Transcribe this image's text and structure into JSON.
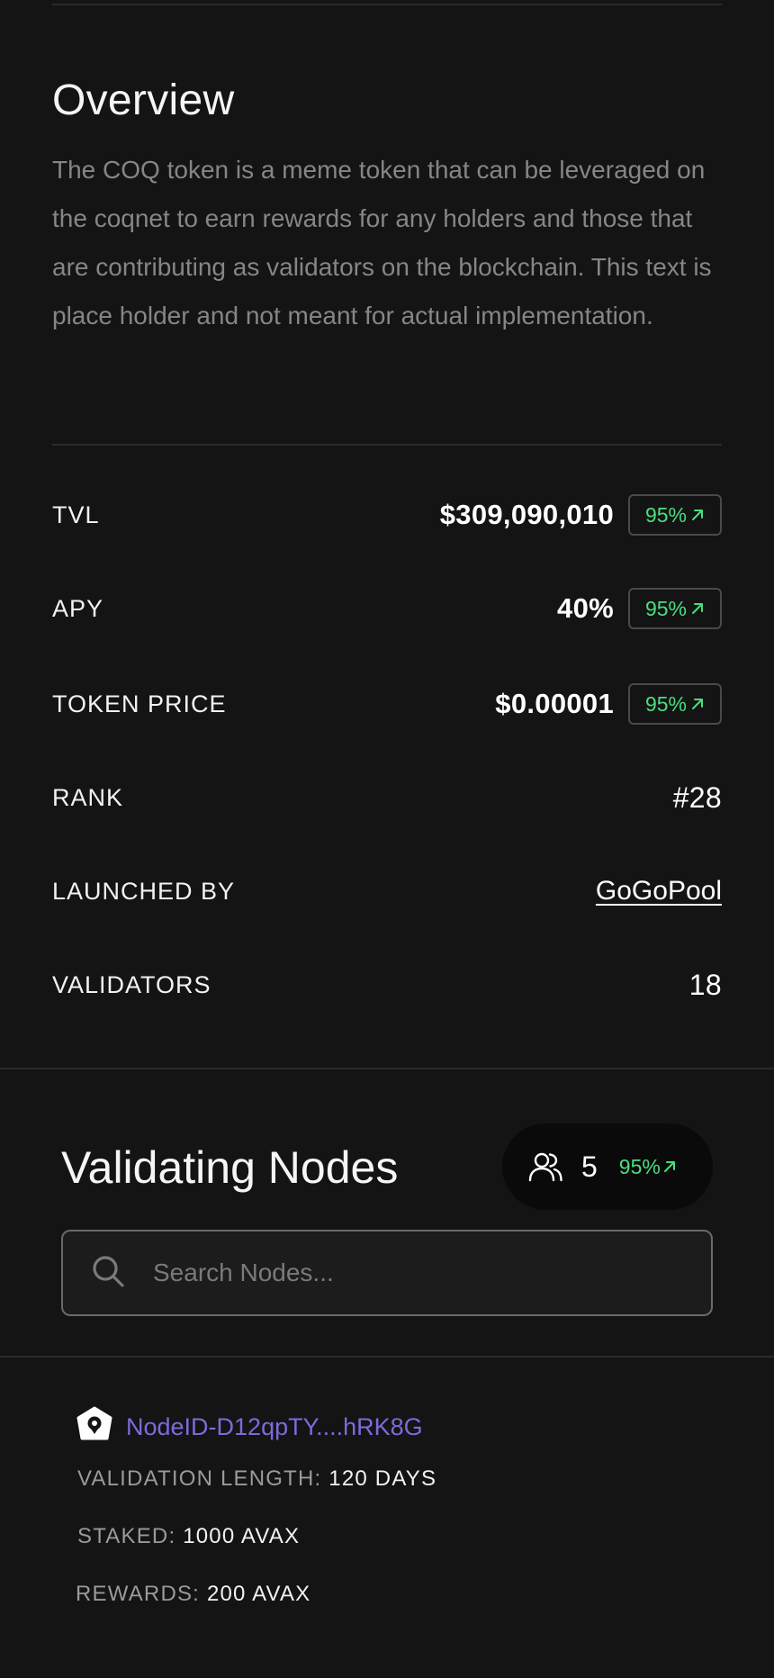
{
  "overview": {
    "title": "Overview",
    "description": "The COQ token is a meme token that can be leveraged on the coqnet to earn rewards for any holders and those that are contributing as validators on the blockchain. This text is place holder and not meant for actual implementation."
  },
  "stats": {
    "tvl": {
      "label": "TVL",
      "value": "$309,090,010",
      "change": "95%"
    },
    "apy": {
      "label": "APY",
      "value": "40%",
      "change": "95%"
    },
    "token_price": {
      "label": "TOKEN PRICE",
      "value": "$0.00001",
      "change": "95%"
    },
    "rank": {
      "label": "RANK",
      "value": "#28"
    },
    "launched_by": {
      "label": "LAUNCHED BY",
      "value": "GoGoPool"
    },
    "validators": {
      "label": "VALIDATORS",
      "value": "18"
    }
  },
  "nodes": {
    "title": "Validating Nodes",
    "count": "5",
    "change": "95%",
    "search_placeholder": "Search Nodes...",
    "items": [
      {
        "id": "NodeID-D12qpTY....hRK8G",
        "validation_length_label": "VALIDATION LENGTH:",
        "validation_length": "120 DAYS",
        "staked_label": "STAKED:",
        "staked": "1000 AVAX",
        "rewards_label": "REWARDS:",
        "rewards": "200 AVAX"
      }
    ]
  },
  "icons": {
    "trend": "arrow-up-right-icon",
    "users": "users-icon",
    "search": "search-icon",
    "node": "node-badge-icon"
  },
  "colors": {
    "background": "#141414",
    "positive": "#4ade80",
    "link_purple": "#7b6bdb",
    "muted_text": "#85858a"
  }
}
